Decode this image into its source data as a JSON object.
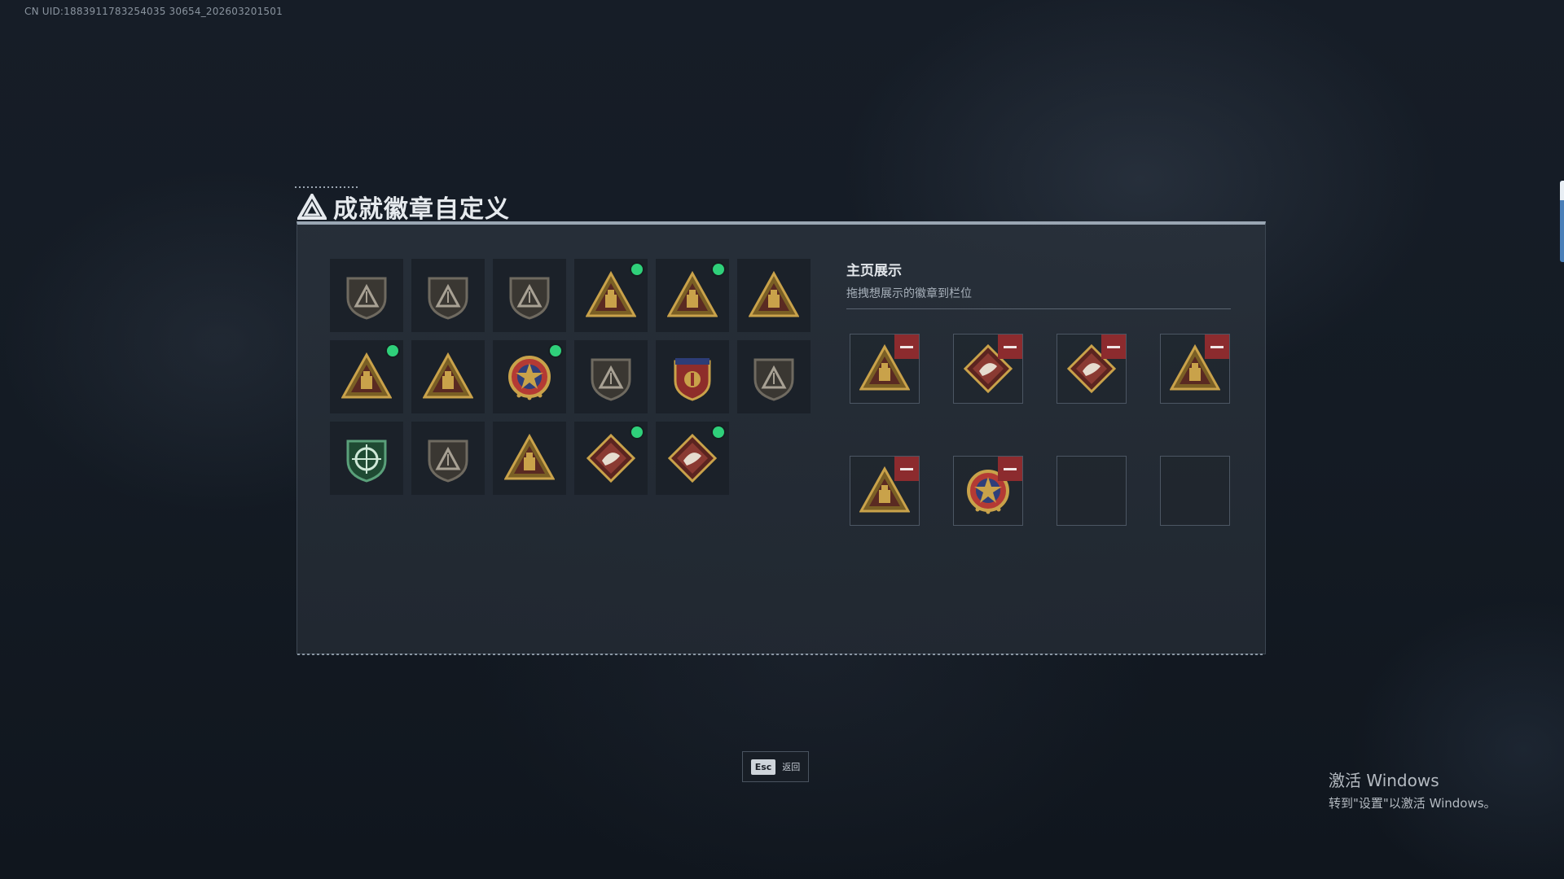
{
  "uid_text": "CN UID:1883911783254035 30654_202603201501",
  "page": {
    "title": "成就徽章自定义",
    "logo_icon": "triangle-logo-icon"
  },
  "badges": [
    {
      "icon": "shield-triangle-badge",
      "style": "dark",
      "new": false
    },
    {
      "icon": "shield-helicopter-badge",
      "style": "dark",
      "new": false
    },
    {
      "icon": "shield-blades-badge",
      "style": "dark",
      "new": false
    },
    {
      "icon": "triangle-crate-badge",
      "style": "gold",
      "new": true
    },
    {
      "icon": "triangle-sb-badge",
      "style": "gold",
      "new": true
    },
    {
      "icon": "triangle-number-one-badge",
      "style": "gold",
      "new": false
    },
    {
      "icon": "triangle-box-badge",
      "style": "gold",
      "new": true
    },
    {
      "icon": "triangle-squad-badge",
      "style": "gold",
      "new": false
    },
    {
      "icon": "star-medal-badge",
      "style": "medal",
      "new": true
    },
    {
      "icon": "shield-eagle-badge",
      "style": "dark",
      "new": false
    },
    {
      "icon": "crest-stars-badge",
      "style": "crest",
      "new": false
    },
    {
      "icon": "round-skull-badge",
      "style": "dark",
      "new": false
    },
    {
      "icon": "green-crosshair-badge",
      "style": "green",
      "new": false
    },
    {
      "icon": "shield-no-gun-badge",
      "style": "dark",
      "new": false
    },
    {
      "icon": "anchor-wings-badge",
      "style": "gold",
      "new": false
    },
    {
      "icon": "diamond-dragon-badge",
      "style": "red",
      "new": true
    },
    {
      "icon": "diamond-runner-badge",
      "style": "red",
      "new": true
    }
  ],
  "showcase": {
    "title": "主页展示",
    "subtitle": "拖拽想展示的徽章到栏位",
    "slots": [
      {
        "icon": "triangle-box-badge",
        "style": "gold",
        "filled": true
      },
      {
        "icon": "diamond-runner-badge",
        "style": "red",
        "filled": true
      },
      {
        "icon": "diamond-dragon-badge",
        "style": "red",
        "filled": true
      },
      {
        "icon": "triangle-crate-badge",
        "style": "gold",
        "filled": true
      },
      {
        "icon": "triangle-sb-badge",
        "style": "gold",
        "filled": true
      },
      {
        "icon": "star-medal-badge",
        "style": "medal",
        "filled": true
      },
      {
        "icon": "",
        "style": "",
        "filled": false
      },
      {
        "icon": "",
        "style": "",
        "filled": false
      }
    ]
  },
  "footer": {
    "esc_key": "Esc",
    "esc_label": "返回"
  },
  "activation": {
    "title": "激活 Windows",
    "subtitle": "转到\"设置\"以激活 Windows。"
  },
  "colors": {
    "new_dot": "#2fd07a",
    "remove_button": "#8c2b2e",
    "gold": "#c9a24a",
    "dark_bronze": "#6f6a60",
    "red_diamond": "#7a2a2a"
  }
}
